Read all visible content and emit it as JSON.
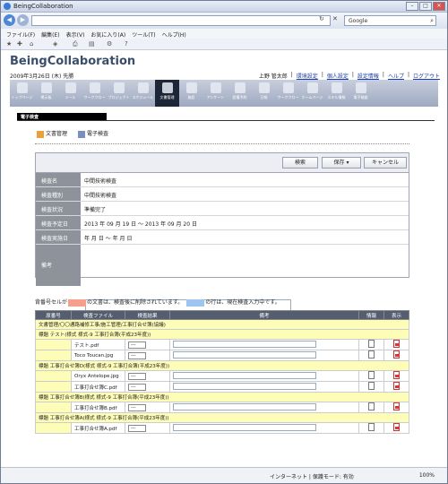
{
  "window": {
    "title": "BeingCollaboration",
    "controls": {
      "minimize": "–",
      "maximize": "□",
      "close": "✕"
    }
  },
  "addressbar": {
    "back": "◀",
    "forward": "▶",
    "url": "",
    "refresh": "↻",
    "stop": "✕",
    "search_placeholder": "Google",
    "search_icon": "search-icon"
  },
  "menu": [
    "ファイル(F)",
    "編集(E)",
    "表示(V)",
    "お気に入り(A)",
    "ツール(T)",
    "ヘルプ(H)"
  ],
  "app": {
    "brand": "BeingCollaboration",
    "date": "2009年3月26日 (木) 先勝",
    "user": "上野 管太郎",
    "links": [
      "環境設定",
      "個人設定",
      "設定情報",
      "ヘルプ",
      "ログアウト"
    ]
  },
  "toolbar": [
    "トップページ",
    "掲示板",
    "メール",
    "ワークフロー",
    "プロジェクト",
    "スケジュール",
    "文書管理",
    "施設",
    "アンケート",
    "設備予約",
    "日報",
    "ワークフロー",
    "ホームページ",
    "スキル情報",
    "電子検査"
  ],
  "section": {
    "tab": "電子検査"
  },
  "crumbs": [
    "文書管理",
    "電子検査"
  ],
  "form": {
    "buttons": {
      "search": "検索",
      "save": "保存 ▾",
      "cancel": "キャンセル"
    },
    "rows": [
      {
        "label": "検査名",
        "value": "中間技術検査"
      },
      {
        "label": "検査種別",
        "value": "中間技術検査"
      },
      {
        "label": "検査状況",
        "value": "準備完了"
      },
      {
        "label": "検査予定日",
        "value": "2013 年 09 月 19 日 〜 2013 年 09 月 20 日"
      },
      {
        "label": "検査実施日",
        "value": "年 月 日 〜 年 月 日"
      },
      {
        "label": "備考",
        "value": ""
      }
    ]
  },
  "note": {
    "before": "背番号セルが",
    "mid": "の文書は、検査後に削除されています。",
    "after": "の行は、現在検査入力中です。",
    "color1": "#f4a08a",
    "color2": "#9ec5f0"
  },
  "table": {
    "headers": [
      "原番号",
      "検査ファイル",
      "検査結果",
      "備考",
      "情報",
      "表示"
    ],
    "group_title": "文書管理/〇〇通路補修工事/施工管理/工事打合せ簿(協議)",
    "sections": [
      {
        "title": "標題 テスト(様式 様式-9 工事打合簿(平成23年度))",
        "files": [
          "テスト.pdf",
          "Toco Toucan.jpg"
        ]
      },
      {
        "title": "標題 工事打合せ簿D(様式 様式-9 工事打合簿(平成23年度))",
        "files": [
          "Oryx Antelope.jpg",
          "工事打合せ簿C.pdf"
        ]
      },
      {
        "title": "標題 工事打合せ簿B(様式 様式-9 工事打合簿(平成23年度))",
        "files": [
          "工事打合せ簿B.pdf"
        ]
      },
      {
        "title": "標題 工事打合せ簿A(様式 様式-9 工事打合簿(平成23年度))",
        "files": [
          "工事打合せ簿A.pdf"
        ]
      }
    ],
    "select_value": "---"
  },
  "status": {
    "left": "",
    "zone": "インターネット | 保護モード: 有効",
    "zoom": "100%"
  }
}
